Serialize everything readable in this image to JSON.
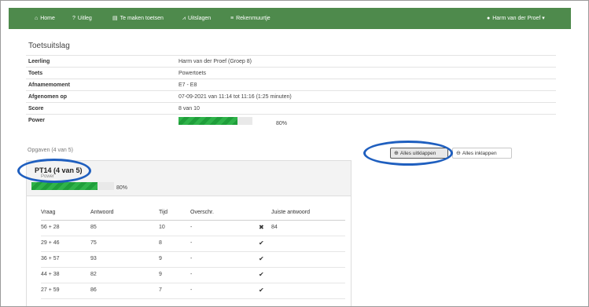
{
  "navbar": {
    "items": [
      {
        "icon": "home-icon",
        "glyph": "⌂",
        "label": "Home"
      },
      {
        "icon": "question-circle-icon",
        "glyph": "?",
        "label": "Uitleg"
      },
      {
        "icon": "file-icon",
        "glyph": "▤",
        "label": "Te maken toetsen"
      },
      {
        "icon": "chart-icon",
        "glyph": "⩘",
        "label": "Uitslagen"
      },
      {
        "icon": "list-icon",
        "glyph": "≡",
        "label": "Rekenmuurtje"
      }
    ],
    "user": {
      "icon": "user-icon",
      "glyph": "●",
      "label": "Harm van der Proef",
      "caret": "▾"
    }
  },
  "page": {
    "title": "Toetsuitslag",
    "summary": [
      {
        "label": "Leerling",
        "value": "Harm van der Proef (Groep 8)"
      },
      {
        "label": "Toets",
        "value": "Powertoets"
      },
      {
        "label": "Afnamemoment",
        "value": "E7 - E8"
      },
      {
        "label": "Afgenomen op",
        "value": "07-09-2021 van 11:14 tot 11:16 (1:25 minuten)"
      },
      {
        "label": "Score",
        "value": "8 van 10"
      },
      {
        "label": "Power",
        "value": "80%",
        "progress": 0.8
      }
    ],
    "opgaven_label": "Opgaven (4 van 5)"
  },
  "buttons": {
    "expand_all": "Alles uitklappen",
    "collapse_all": "Alles inklappen"
  },
  "card": {
    "title": "PT14 (4 van 5)",
    "subtitle": "Power",
    "power_pct": "80%",
    "progress": 0.8,
    "columns": [
      "Vraag",
      "Antwoord",
      "Tijd",
      "Overschr.",
      "Juiste antwoord"
    ],
    "rows": [
      {
        "vraag": "56 + 28",
        "antwoord": "85",
        "tijd": "10",
        "overschr": "-",
        "correct": false,
        "juiste": "84"
      },
      {
        "vraag": "29 + 46",
        "antwoord": "75",
        "tijd": "8",
        "overschr": "-",
        "correct": true,
        "juiste": ""
      },
      {
        "vraag": "36 + 57",
        "antwoord": "93",
        "tijd": "9",
        "overschr": "-",
        "correct": true,
        "juiste": ""
      },
      {
        "vraag": "44 + 38",
        "antwoord": "82",
        "tijd": "9",
        "overschr": "-",
        "correct": true,
        "juiste": ""
      },
      {
        "vraag": "27 + 59",
        "antwoord": "86",
        "tijd": "7",
        "overschr": "-",
        "correct": true,
        "juiste": ""
      }
    ]
  },
  "marks": {
    "correct": "✔",
    "wrong": "✖"
  },
  "colors": {
    "navbar": "#4e8a4c",
    "progress": "#2fb34a",
    "highlight": "#1f5fbf"
  }
}
